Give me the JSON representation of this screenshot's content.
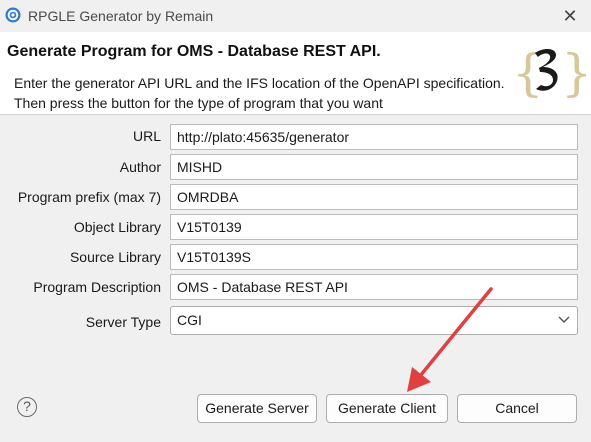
{
  "window": {
    "title": "RPGLE Generator by Remain",
    "close_glyph": "✕"
  },
  "header": {
    "title": "Generate Program for OMS - Database REST API.",
    "description": "Enter the generator API URL and the IFS location of the OpenAPI specification. Then press the button for the type of program that you want",
    "logo_glyph": "{3}"
  },
  "form": {
    "url": {
      "label": "URL",
      "value": "http://plato:45635/generator"
    },
    "author": {
      "label": "Author",
      "value": "MISHD"
    },
    "prefix": {
      "label": "Program prefix (max 7)",
      "value": "OMRDBA"
    },
    "object_library": {
      "label": "Object Library",
      "value": "V15T0139"
    },
    "source_library": {
      "label": "Source Library",
      "value": "V15T0139S"
    },
    "description": {
      "label": "Program Description",
      "value": "OMS - Database REST API"
    },
    "server_type": {
      "label": "Server Type",
      "value": "CGI"
    }
  },
  "buttons": {
    "help": "?",
    "generate_server": "Generate Server",
    "generate_client": "Generate Client",
    "cancel": "Cancel"
  },
  "colors": {
    "annotation_arrow": "#e04040",
    "app_icon": "#2b7bc8"
  }
}
